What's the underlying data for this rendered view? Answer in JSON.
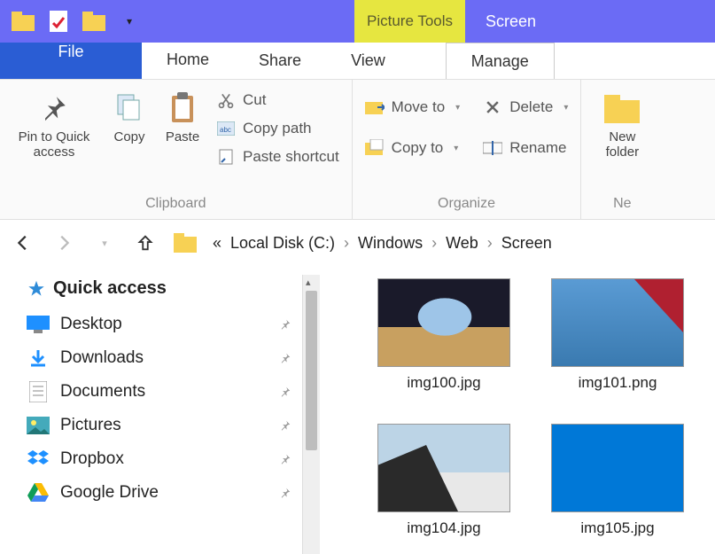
{
  "titlebar": {
    "context_tab": "Picture Tools",
    "window_title": "Screen"
  },
  "tabs": {
    "file": "File",
    "home": "Home",
    "share": "Share",
    "view": "View",
    "manage": "Manage"
  },
  "ribbon": {
    "pin_to_quick": "Pin to Quick access",
    "copy": "Copy",
    "paste": "Paste",
    "cut": "Cut",
    "copy_path": "Copy path",
    "paste_shortcut": "Paste shortcut",
    "clipboard_group": "Clipboard",
    "move_to": "Move to",
    "copy_to": "Copy to",
    "delete": "Delete",
    "rename": "Rename",
    "organize_group": "Organize",
    "new_folder": "New folder",
    "new_group": "Ne"
  },
  "breadcrumbs": {
    "prefix": "«",
    "items": [
      "Local Disk (C:)",
      "Windows",
      "Web",
      "Screen"
    ]
  },
  "nav": {
    "quick_access": "Quick access",
    "items": [
      {
        "label": "Desktop"
      },
      {
        "label": "Downloads"
      },
      {
        "label": "Documents"
      },
      {
        "label": "Pictures"
      },
      {
        "label": "Dropbox"
      },
      {
        "label": "Google Drive"
      }
    ]
  },
  "files": [
    {
      "name": "img100.jpg"
    },
    {
      "name": "img101.png"
    },
    {
      "name": "img104.jpg"
    },
    {
      "name": "img105.jpg"
    }
  ]
}
